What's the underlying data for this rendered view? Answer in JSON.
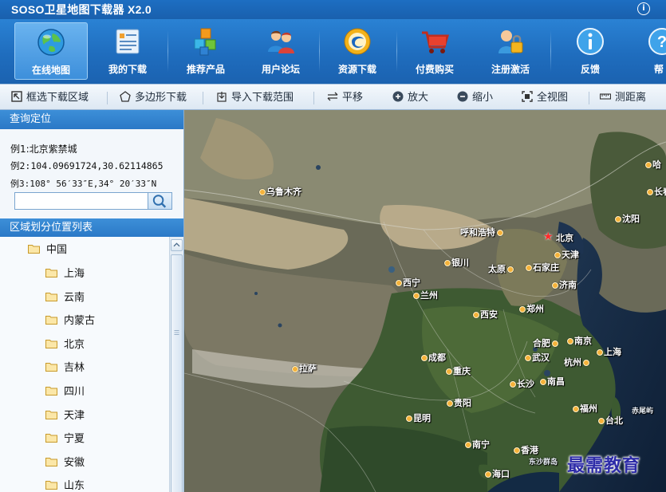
{
  "window": {
    "title": "SOSO卫星地图下载器 X2.0",
    "info_symbol": "ⓘ"
  },
  "toolbar": {
    "items": [
      {
        "label": "在线地图",
        "icon": "globe-icon",
        "active": true
      },
      {
        "label": "我的下载",
        "icon": "download-list-icon"
      },
      {
        "label": "推荐产品",
        "icon": "cubes-icon"
      },
      {
        "label": "用户论坛",
        "icon": "users-icon"
      },
      {
        "label": "资源下载",
        "icon": "resource-icon"
      },
      {
        "label": "付费购买",
        "icon": "cart-icon"
      },
      {
        "label": "注册激活",
        "icon": "lock-icon"
      },
      {
        "label": "反馈",
        "icon": "info-icon"
      },
      {
        "label": "帮",
        "icon": "help-icon"
      }
    ]
  },
  "subtoolbar": {
    "items": [
      {
        "label": "框选下载区域",
        "icon": "select-box-icon"
      },
      {
        "label": "多边形下载",
        "icon": "polygon-icon"
      },
      {
        "label": "导入下载范围",
        "icon": "import-icon"
      },
      {
        "label": "平移",
        "icon": "pan-icon"
      },
      {
        "label": "放大",
        "icon": "zoom-in-icon"
      },
      {
        "label": "缩小",
        "icon": "zoom-out-icon"
      },
      {
        "label": "全视图",
        "icon": "full-view-icon"
      },
      {
        "label": "测距离",
        "icon": "ruler-icon"
      }
    ]
  },
  "sidebar": {
    "query_header": "查询定位",
    "examples": [
      "例1:北京紫禁城",
      "例2:104.09691724,30.62114865",
      "例3:108° 56′33″E,34° 20′33″N"
    ],
    "search_value": "",
    "region_header": "区域划分位置列表",
    "tree_root": "中国",
    "tree_items": [
      "上海",
      "云南",
      "内蒙古",
      "北京",
      "吉林",
      "四川",
      "天津",
      "宁夏",
      "安徽",
      "山东"
    ]
  },
  "map": {
    "cities": [
      "乌鲁木齐",
      "哈",
      "长春",
      "沈阳",
      "呼和浩特",
      "北京",
      "天津",
      "银川",
      "太原",
      "石家庄",
      "西宁",
      "兰州",
      "济南",
      "西安",
      "郑州",
      "合肥",
      "南京",
      "上海",
      "武汉",
      "杭州",
      "拉萨",
      "成都",
      "重庆",
      "长沙",
      "南昌",
      "贵阳",
      "福州",
      "台北",
      "赤尾屿",
      "昆明",
      "南宁",
      "香港",
      "东沙群岛",
      "海口"
    ],
    "watermark": "最需教育"
  },
  "colors": {
    "toolbar_blue": "#1f6dbe",
    "header_blue": "#2a78c6",
    "capital_star": "#ff2b2b"
  }
}
